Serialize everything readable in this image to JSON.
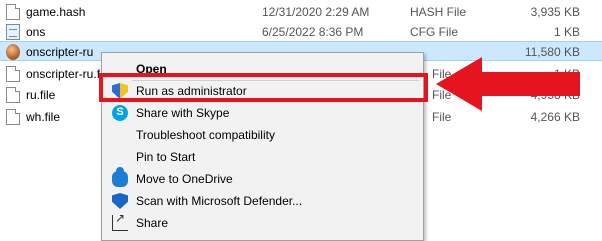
{
  "files": [
    {
      "name": "game.hash",
      "date": "12/31/2020 2:29 AM",
      "type": "HASH File",
      "size": "3,935 KB",
      "icon": "file-icon"
    },
    {
      "name": "ons",
      "date": "6/25/2022 8:36 PM",
      "type": "CFG File",
      "size": "1 KB",
      "icon": "cfg-icon"
    },
    {
      "name": "onscripter-ru",
      "date": "",
      "type": "",
      "size": "11,580 KB",
      "icon": "app-icon"
    },
    {
      "name": "onscripter-ru.f",
      "date": "",
      "type": "File",
      "size": "1 KB",
      "icon": "file-icon"
    },
    {
      "name": "ru.file",
      "date": "",
      "type": "File",
      "size": "4,958 KB",
      "icon": "file-icon"
    },
    {
      "name": "wh.file",
      "date": "",
      "type": "File",
      "size": "4,266 KB",
      "icon": "file-icon"
    }
  ],
  "context_menu": {
    "items": [
      {
        "label": "Open",
        "icon": "",
        "bold": true
      },
      {
        "label": "Run as administrator",
        "icon": "uac-shield-icon"
      },
      {
        "label": "Share with Skype",
        "icon": "skype-icon"
      },
      {
        "label": "Troubleshoot compatibility",
        "icon": ""
      },
      {
        "label": "Pin to Start",
        "icon": ""
      },
      {
        "label": "Move to OneDrive",
        "icon": "onedrive-icon"
      },
      {
        "label": "Scan with Microsoft Defender...",
        "icon": "defender-icon"
      },
      {
        "label": "Share",
        "icon": "share-icon"
      }
    ]
  },
  "annotation": {
    "highlight_color": "#e6141e",
    "target": "Run as administrator"
  },
  "colors": {
    "selection": "#cce8ff",
    "menu_bg": "#f2f2f2"
  }
}
